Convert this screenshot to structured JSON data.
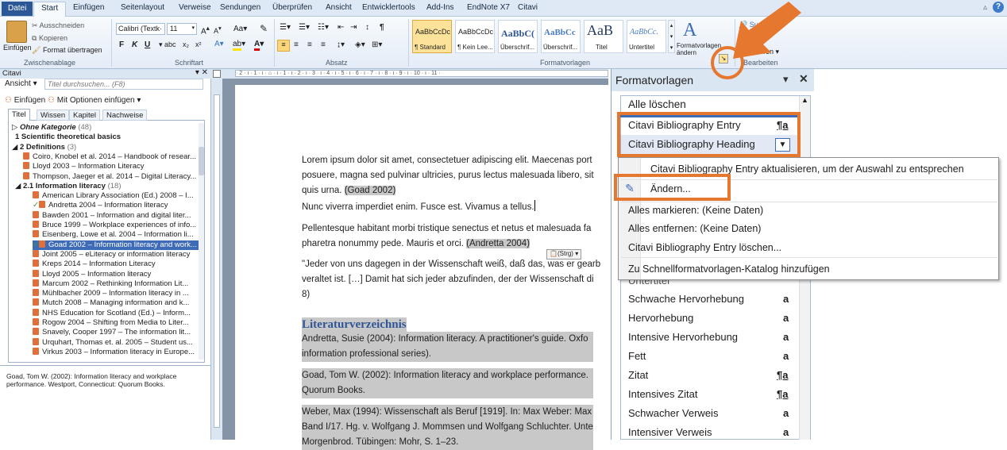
{
  "ribbon_tabs": [
    "Datei",
    "Start",
    "Einfügen",
    "Seitenlayout",
    "Verweise",
    "Sendungen",
    "Überprüfen",
    "Ansicht",
    "Entwicklertools",
    "Add-Ins",
    "EndNote X7",
    "Citavi"
  ],
  "clipboard": {
    "cut": "Ausschneiden",
    "copy": "Kopieren",
    "paste": "Einfügen",
    "format_painter": "Format übertragen",
    "group": "Zwischenablage"
  },
  "font": {
    "name": "Calibri (Textk·",
    "size": "11",
    "group": "Schriftart"
  },
  "paragraph": {
    "group": "Absatz"
  },
  "styles": {
    "items": [
      {
        "sample": "AaBbCcDc",
        "label": "¶ Standard"
      },
      {
        "sample": "AaBbCcDc",
        "label": "¶ Kein Lee..."
      },
      {
        "sample": "AaBbC(",
        "label": "Überschrif..."
      },
      {
        "sample": "AaBbCc",
        "label": "Überschrif..."
      },
      {
        "sample": "AaB",
        "label": "Titel"
      },
      {
        "sample": "AaBbCc.",
        "label": "Untertitel"
      }
    ],
    "change_styles": "Formatvorlagen ändern",
    "group": "Formatvorlagen"
  },
  "editing": {
    "group": "Bearbeiten"
  },
  "citavi": {
    "title": "Citavi",
    "view": "Ansicht",
    "search_placeholder": "Titel durchsuchen... (F8)",
    "insert": "Einfügen",
    "insert_options": "Mit Optionen einfügen",
    "tabs": [
      "Titel",
      "Wissen",
      "Kapitel",
      "Nachweise"
    ],
    "tree": [
      {
        "text": "Ohne Kategorie",
        "count": "(48)",
        "level": 0,
        "kind": "cat"
      },
      {
        "text": "1 Scientific theoretical basics",
        "level": 1,
        "kind": "cat"
      },
      {
        "text": "2 Definitions",
        "count": "(3)",
        "level": 0,
        "kind": "cat"
      },
      {
        "text": "Coiro, Knobel et al. 2014 – Handbook of resear...",
        "level": 2,
        "kind": "ref"
      },
      {
        "text": "Lloyd 2003 – Information Literacy",
        "level": 2,
        "kind": "ref"
      },
      {
        "text": "Thompson, Jaeger et al. 2014 – Digital Literacy...",
        "level": 2,
        "kind": "ref"
      },
      {
        "text": "2.1 Information literacy",
        "count": "(18)",
        "level": 1,
        "kind": "cat"
      },
      {
        "text": "American Library Association (Ed.) 2008 – I...",
        "level": 3,
        "kind": "ref"
      },
      {
        "text": "Andretta 2004 – Information literacy",
        "level": 3,
        "kind": "ref",
        "check": true
      },
      {
        "text": "Bawden 2001 – Information and digital liter...",
        "level": 3,
        "kind": "ref"
      },
      {
        "text": "Bruce 1999 – Workplace experiences of info...",
        "level": 3,
        "kind": "ref"
      },
      {
        "text": "Eisenberg, Lowe et al. 2004 – Information li...",
        "level": 3,
        "kind": "ref"
      },
      {
        "text": "Goad 2002 – Information literacy and work...",
        "level": 3,
        "kind": "ref",
        "check": true,
        "selected": true
      },
      {
        "text": "Joint 2005 – eLiteracy or information literacy",
        "level": 3,
        "kind": "ref"
      },
      {
        "text": "Kreps 2014 – Information Literacy",
        "level": 3,
        "kind": "ref"
      },
      {
        "text": "Lloyd 2005 – Information literacy",
        "level": 3,
        "kind": "ref"
      },
      {
        "text": "Marcum 2002 – Rethinking Information Lit...",
        "level": 3,
        "kind": "ref"
      },
      {
        "text": "Mühlbacher 2009 – Information literacy in ...",
        "level": 3,
        "kind": "ref"
      },
      {
        "text": "Mutch 2008 – Managing information and k...",
        "level": 3,
        "kind": "ref"
      },
      {
        "text": "NHS Education for Scotland (Ed.) – Inform...",
        "level": 3,
        "kind": "ref"
      },
      {
        "text": "Rogow 2004 – Shifting from Media to Liter...",
        "level": 3,
        "kind": "ref"
      },
      {
        "text": "Snavely, Cooper 1997 – The information lit...",
        "level": 3,
        "kind": "ref"
      },
      {
        "text": "Urquhart, Thomas et. al. 2005 – Student us...",
        "level": 3,
        "kind": "ref"
      },
      {
        "text": "Virkus 2003 – Information literacy in Europe...",
        "level": 3,
        "kind": "ref"
      }
    ],
    "preview": "Goad, Tom W. (2002): Information literacy and workplace performance. Westport, Connecticut: Quorum Books."
  },
  "document": {
    "p1": [
      "Lorem ipsum dolor sit amet, consectetuer adipiscing elit. Maecenas port",
      "posuere, magna sed pulvinar ultricies, purus lectus malesuada libero, sit",
      "quis urna."
    ],
    "cite1": "(Goad 2002)",
    "p2": "Nunc viverra imperdiet enim. Fusce est. Vivamus a tellus.",
    "p3": [
      "Pellentesque habitant morbi tristique senectus et netus et malesuada fa",
      "pharetra nonummy pede. Mauris et orci."
    ],
    "cite2": "(Andretta 2004)",
    "paste_tag": "(Strg) ▾",
    "p4": [
      "\"Jeder von uns dagegen in der Wissenschaft weiß, daß das, was er gearb",
      "veraltet ist. […] Damit hat sich jeder abzufinden, der der Wissenschaft di",
      "8)"
    ],
    "heading": "Literaturverzeichnis",
    "bib": [
      "Andretta, Susie (2004): Information literacy. A practitioner's guide. Oxfo",
      "information professional series).",
      "Goad, Tom W. (2002): Information literacy and workplace performance.",
      "Quorum Books.",
      "Weber, Max (1994): Wissenschaft als Beruf [1919]. In: Max Weber: Max",
      "Band I/17. Hg. v. Wolfgang J. Mommsen und Wolfgang Schluchter. Unte",
      "Morgenbrod. Tübingen: Mohr, S. 1–23."
    ]
  },
  "formatvorlagen": {
    "title": "Formatvorlagen",
    "clear_all": "Alle löschen",
    "items": [
      {
        "label": "Citavi Bibliography Entry",
        "sym": "¶a"
      },
      {
        "label": "Citavi Bibliography Heading",
        "sym": ""
      },
      {
        "label": "Untertitel",
        "sym": "¶a"
      },
      {
        "label": "Schwache Hervorhebung",
        "sym": "a"
      },
      {
        "label": "Hervorhebung",
        "sym": "a"
      },
      {
        "label": "Intensive Hervorhebung",
        "sym": "a"
      },
      {
        "label": "Fett",
        "sym": "a"
      },
      {
        "label": "Zitat",
        "sym": "¶a"
      },
      {
        "label": "Intensives Zitat",
        "sym": "¶a"
      },
      {
        "label": "Schwacher Verweis",
        "sym": "a"
      },
      {
        "label": "Intensiver Verweis",
        "sym": "a"
      }
    ]
  },
  "context_menu": [
    "Citavi Bibliography Entry aktualisieren, um der Auswahl zu entsprechen",
    "Ändern...",
    "Alles markieren: (Keine Daten)",
    "Alles entfernen: (Keine Daten)",
    "Citavi Bibliography Entry löschen...",
    "Zu Schnellformatvorlagen-Katalog hinzufügen"
  ],
  "colors": {
    "accent": "#e6772e",
    "word_blue": "#2b5797",
    "selection": "#3d6bb7",
    "heading": "#2f5597"
  }
}
